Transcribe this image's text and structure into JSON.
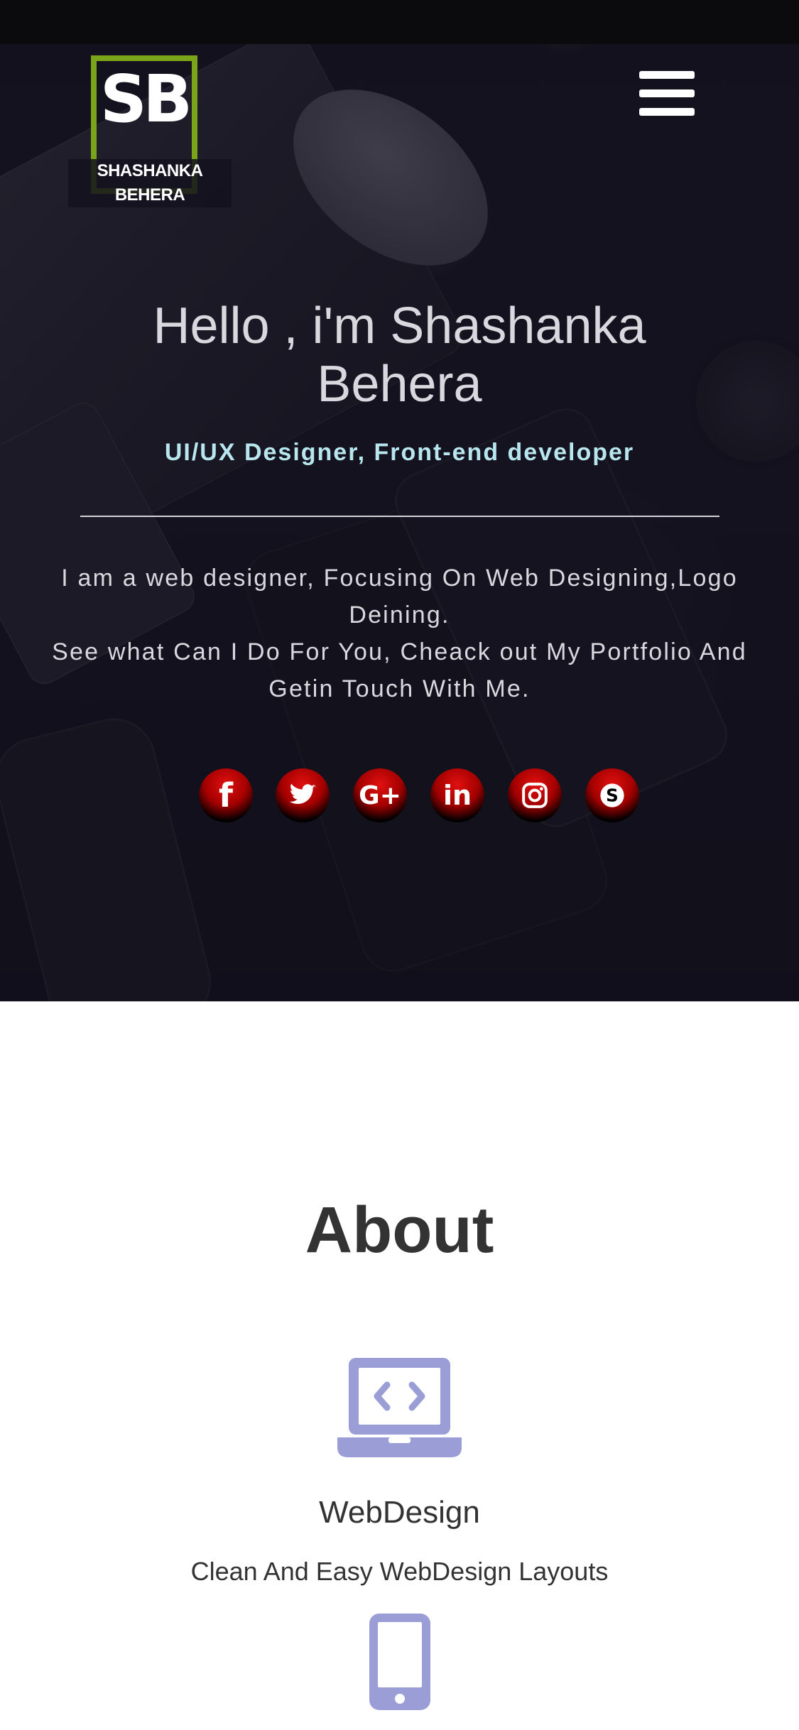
{
  "brand": {
    "initials": "SB",
    "name": "SHASHANKA BEHERA",
    "accent_color": "#7aa51a"
  },
  "hero": {
    "title": "Hello , i'm Shashanka Behera",
    "subtitle": "UI/UX Designer, Front-end developer",
    "intro_lines": [
      "I am a web designer, Focusing On Web Designing,Logo Deining.",
      "See what Can I Do For You, Cheack out My Portfolio And Getin Touch With Me."
    ]
  },
  "social": [
    {
      "icon": "facebook-icon",
      "glyph": "f"
    },
    {
      "icon": "twitter-icon",
      "glyph": "🐦"
    },
    {
      "icon": "google-plus-icon",
      "glyph": "G+"
    },
    {
      "icon": "linkedin-icon",
      "glyph": "in"
    },
    {
      "icon": "instagram-icon",
      "glyph": "◎"
    },
    {
      "icon": "skype-icon",
      "glyph": "S"
    }
  ],
  "about": {
    "title": "About",
    "services": [
      {
        "icon": "laptop-code-icon",
        "title": "WebDesign",
        "description": "Clean And Easy WebDesign Layouts"
      },
      {
        "icon": "mobile-phone-icon"
      }
    ]
  },
  "colors": {
    "icon_color": "#9b9dd6",
    "social_color": "#d10a0a",
    "subtitle_color": "#b8e6ef"
  }
}
